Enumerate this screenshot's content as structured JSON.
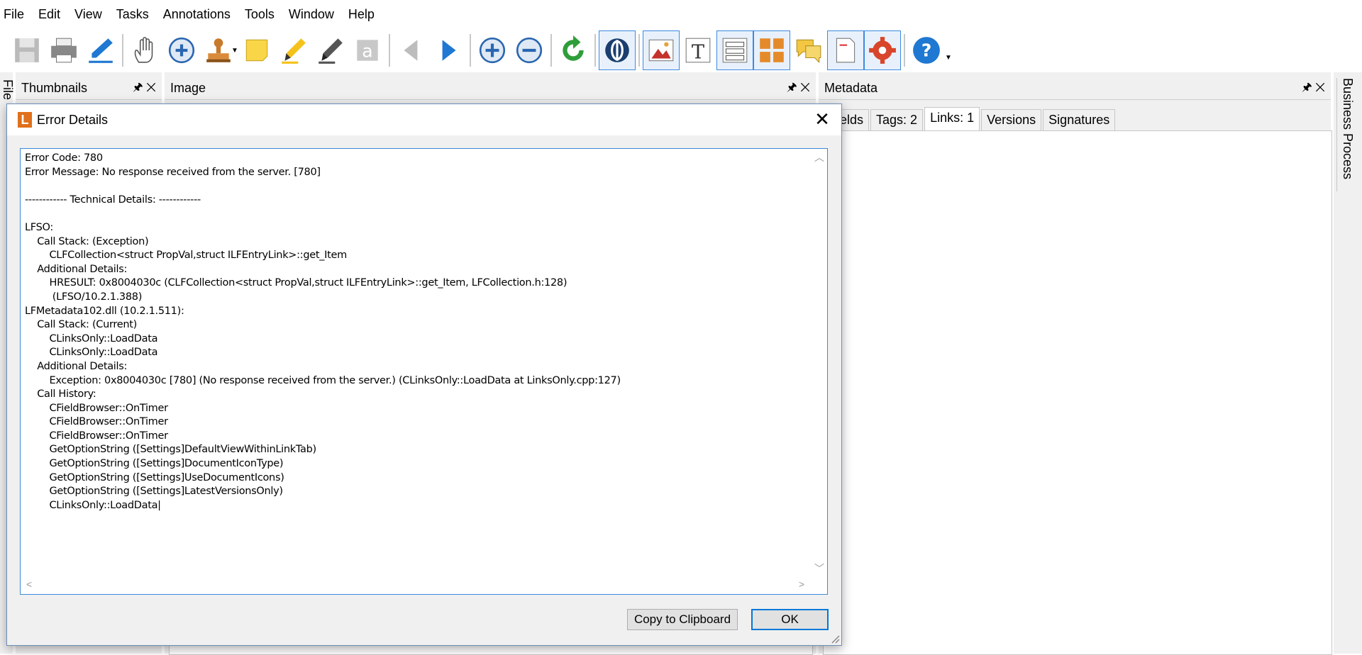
{
  "menu": [
    "File",
    "Edit",
    "View",
    "Tasks",
    "Annotations",
    "Tools",
    "Window",
    "Help"
  ],
  "panes": {
    "thumbnails": {
      "title": "Thumbnails",
      "pin": "🖈",
      "close": "✕"
    },
    "image": {
      "title": "Image",
      "pin": "🖈",
      "close": "✕"
    },
    "metadata": {
      "title": "Metadata",
      "pin": "🖈",
      "close": "✕"
    },
    "left_side_tab": "Electronic File",
    "right_side_tab": "Business Process"
  },
  "metadata_tabs": [
    "elds",
    "Tags: 2",
    "Links: 1",
    "Versions",
    "Signatures"
  ],
  "dialog": {
    "logo": "L",
    "title": "Error Details",
    "close": "✕",
    "text": "Error Code: 780\nError Message: No response received from the server. [780]\n\n------------ Technical Details: ------------\n\nLFSO:\n    Call Stack: (Exception)\n        CLFCollection<struct PropVal,struct ILFEntryLink>::get_Item\n    Additional Details:\n        HRESULT: 0x8004030c (CLFCollection<struct PropVal,struct ILFEntryLink>::get_Item, LFCollection.h:128)\n         (LFSO/10.2.1.388)\nLFMetadata102.dll (10.2.1.511):\n    Call Stack: (Current)\n        CLinksOnly::LoadData\n        CLinksOnly::LoadData\n    Additional Details:\n        Exception: 0x8004030c [780] (No response received from the server.) (CLinksOnly::LoadData at LinksOnly.cpp:127)\n    Call History:\n        CFieldBrowser::OnTimer\n        CFieldBrowser::OnTimer\n        CFieldBrowser::OnTimer\n        GetOptionString ([Settings]DefaultViewWithinLinkTab)\n        GetOptionString ([Settings]DocumentIconType)\n        GetOptionString ([Settings]UseDocumentIcons)\n        GetOptionString ([Settings]LatestVersionsOnly)\n        CLinksOnly::LoadData|",
    "copy_label": "Copy to Clipboard",
    "ok_label": "OK"
  },
  "colors": {
    "accent": "#0078d7",
    "logo": "#e0701b",
    "toolbar_blue": "#1f78d1"
  }
}
